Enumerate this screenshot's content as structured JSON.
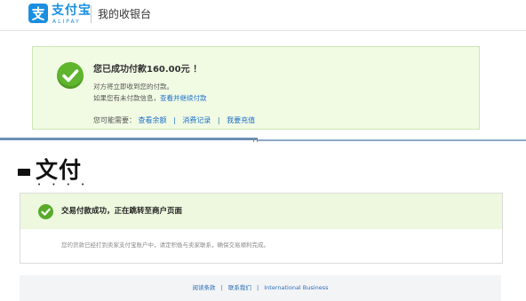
{
  "top": {
    "brand_cn": "支付宝",
    "brand_en": "ALIPAY",
    "page_title": "我的收银台",
    "success": {
      "title": "您已成功付款160.00元 ！",
      "line1": "对方将立即收到您的付款。",
      "line2_text": "如果您有未付款信息，",
      "line2_link": "查看并继续付款",
      "links_prefix": "您可能需要：",
      "links": [
        "查看余额",
        "消费记录",
        "我要充值"
      ],
      "separator": "|"
    }
  },
  "bottom": {
    "brand_partial": "文付",
    "dots": "• • • •",
    "title": "交易付款成功，正在跳转至商户页面",
    "message": "您的货款已经打到卖家支付宝账户中，请定积极与卖家联系，确保交易顺利完成。",
    "footer_links": [
      "阅读条款",
      "联系我们",
      "International Business"
    ],
    "footer_separator": "|"
  },
  "colors": {
    "brand_blue": "#1a8fe1",
    "success_green": "#5fb52c",
    "link_blue": "#1e6fc8",
    "success_bg": "#f1fbe4"
  }
}
